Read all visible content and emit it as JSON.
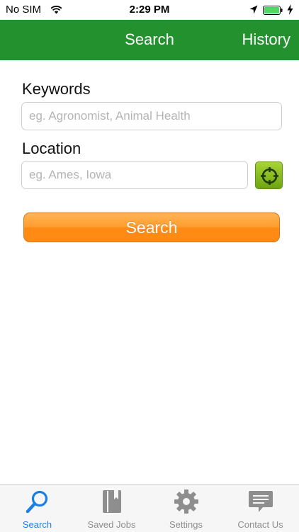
{
  "status_bar": {
    "carrier": "No SIM",
    "time": "2:29 PM"
  },
  "nav": {
    "title": "Search",
    "history_label": "History",
    "bar_color": "#23912d"
  },
  "form": {
    "keywords_label": "Keywords",
    "keywords_placeholder": "eg. Agronomist, Animal Health",
    "keywords_value": "",
    "location_label": "Location",
    "location_placeholder": "eg. Ames, Iowa",
    "location_value": "",
    "search_button_label": "Search",
    "search_button_color": "#ff8a14"
  },
  "tabs": [
    {
      "label": "Search",
      "icon": "magnifier-icon",
      "active": true
    },
    {
      "label": "Saved Jobs",
      "icon": "book-icon",
      "active": false
    },
    {
      "label": "Settings",
      "icon": "gear-icon",
      "active": false
    },
    {
      "label": "Contact Us",
      "icon": "chat-bubble-icon",
      "active": false
    }
  ],
  "colors": {
    "tab_active": "#1a7fe6",
    "tab_inactive": "#8e8e8e"
  }
}
